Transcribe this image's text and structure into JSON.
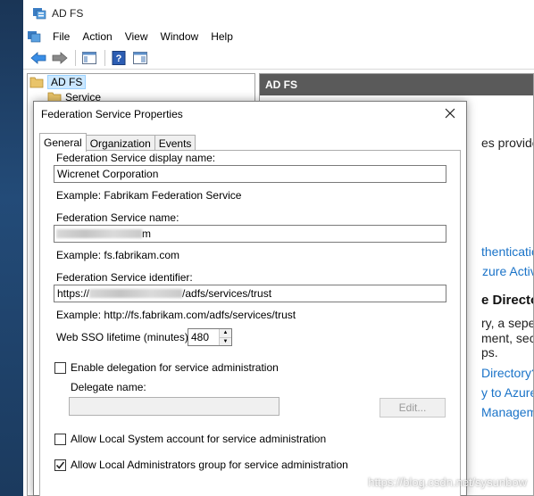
{
  "window": {
    "title": "AD FS"
  },
  "menu": [
    "File",
    "Action",
    "View",
    "Window",
    "Help"
  ],
  "tree": {
    "root": "AD FS",
    "child": "Service"
  },
  "right_pane": {
    "header": "AD FS",
    "lines": [
      "es provides s",
      "thentication w",
      "zure Active D",
      "e Directory",
      "ry, a seperate",
      "ment, securit",
      "ps.",
      "Directory?",
      "y to Azure Act",
      "Management"
    ]
  },
  "dialog": {
    "title": "Federation Service Properties",
    "tabs": [
      "General",
      "Organization",
      "Events"
    ],
    "display_name_label": "Federation Service display name:",
    "display_name_value": "Wicrenet Corporation",
    "display_name_example": "Example: Fabrikam Federation Service",
    "service_name_label": "Federation Service name:",
    "service_name_value_suffix": "m",
    "service_name_example": "Example: fs.fabrikam.com",
    "identifier_label": "Federation Service identifier:",
    "identifier_prefix": "https://",
    "identifier_suffix": "/adfs/services/trust",
    "identifier_example": "Example: http://fs.fabrikam.com/adfs/services/trust",
    "sso_label": "Web SSO lifetime (minutes):",
    "sso_value": "480",
    "delegation_label": "Enable delegation for service administration",
    "delegation_checked": false,
    "delegate_name_label": "Delegate name:",
    "delegate_name_value": "",
    "edit_button": "Edit...",
    "local_system_label": "Allow Local System account for service administration",
    "local_system_checked": false,
    "local_admins_label": "Allow Local Administrators group for service administration",
    "local_admins_checked": true
  },
  "watermark": "https://blog.csdn.net/sysunbow"
}
